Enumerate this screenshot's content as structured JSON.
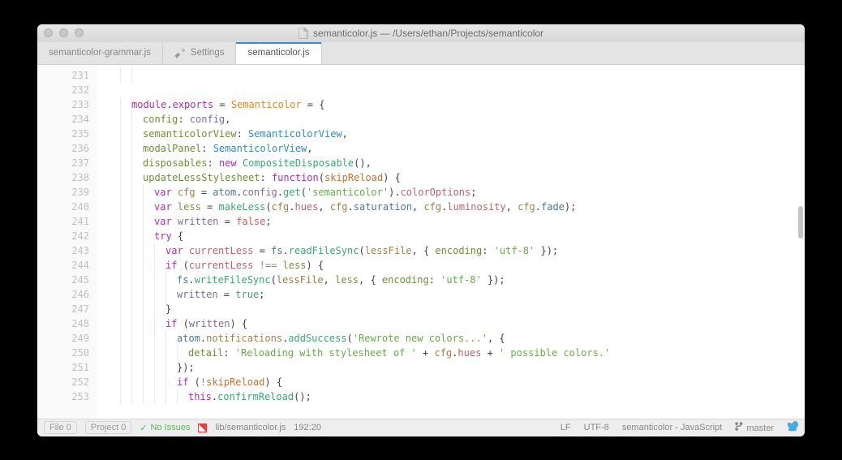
{
  "window": {
    "title": "semanticolor.js — /Users/ethan/Projects/semanticolor"
  },
  "tabs": [
    {
      "label": "semanticolor-grammar.js",
      "icon": null,
      "active": false
    },
    {
      "label": "Settings",
      "icon": "settings",
      "active": false
    },
    {
      "label": "semanticolor.js",
      "icon": null,
      "active": true
    }
  ],
  "gutter": {
    "start": 231,
    "end": 253
  },
  "code_lines": [
    {
      "indent": 2,
      "tokens": []
    },
    {
      "indent": 0,
      "tokens": []
    },
    {
      "indent": 1,
      "tokens": [
        [
          "t-kw",
          "module"
        ],
        [
          "",
          "."
        ],
        [
          "t-kw",
          "exports"
        ],
        [
          "",
          " = "
        ],
        [
          "t-clsA",
          "Semanticolor"
        ],
        [
          "",
          " = {"
        ]
      ]
    },
    {
      "indent": 2,
      "tokens": [
        [
          "t-prop",
          "config"
        ],
        [
          "",
          ": "
        ],
        [
          "t-var1",
          "config"
        ],
        [
          "",
          ","
        ]
      ]
    },
    {
      "indent": 2,
      "tokens": [
        [
          "t-prop",
          "semanticolorView"
        ],
        [
          "",
          ": "
        ],
        [
          "t-clsB",
          "SemanticolorView"
        ],
        [
          "",
          ","
        ]
      ]
    },
    {
      "indent": 2,
      "tokens": [
        [
          "t-prop",
          "modalPanel"
        ],
        [
          "",
          ": "
        ],
        [
          "t-clsB",
          "SemanticolorView"
        ],
        [
          "",
          ","
        ]
      ]
    },
    {
      "indent": 2,
      "tokens": [
        [
          "t-prop",
          "disposables"
        ],
        [
          "",
          ": "
        ],
        [
          "t-kw",
          "new"
        ],
        [
          "",
          " "
        ],
        [
          "t-clsC",
          "CompositeDisposable"
        ],
        [
          "",
          "(),"
        ]
      ]
    },
    {
      "indent": 2,
      "tokens": [
        [
          "t-prop",
          "updateLessStylesheet"
        ],
        [
          "",
          ": "
        ],
        [
          "t-kw",
          "function"
        ],
        [
          "",
          "("
        ],
        [
          "t-param",
          "skipReload"
        ],
        [
          "",
          ") {"
        ]
      ]
    },
    {
      "indent": 3,
      "tokens": [
        [
          "t-kw",
          "var"
        ],
        [
          "",
          " "
        ],
        [
          "t-var2",
          "cfg"
        ],
        [
          "",
          " = "
        ],
        [
          "t-var3",
          "atom"
        ],
        [
          "",
          "."
        ],
        [
          "t-var1",
          "config"
        ],
        [
          "",
          "."
        ],
        [
          "t-fn",
          "get"
        ],
        [
          "",
          "("
        ],
        [
          "t-str",
          "'semanticolor'"
        ],
        [
          "",
          ")."
        ],
        [
          "t-var4",
          "colorOptions"
        ],
        [
          "",
          ";"
        ]
      ]
    },
    {
      "indent": 3,
      "tokens": [
        [
          "t-kw",
          "var"
        ],
        [
          "",
          " "
        ],
        [
          "t-var5",
          "less"
        ],
        [
          "",
          " = "
        ],
        [
          "t-fn",
          "makeLess"
        ],
        [
          "",
          "("
        ],
        [
          "t-var2",
          "cfg"
        ],
        [
          "",
          "."
        ],
        [
          "t-var4",
          "hues"
        ],
        [
          "",
          ", "
        ],
        [
          "t-var2",
          "cfg"
        ],
        [
          "",
          "."
        ],
        [
          "t-var3",
          "saturation"
        ],
        [
          "",
          ", "
        ],
        [
          "t-var2",
          "cfg"
        ],
        [
          "",
          "."
        ],
        [
          "t-var4",
          "luminosity"
        ],
        [
          "",
          ", "
        ],
        [
          "t-var2",
          "cfg"
        ],
        [
          "",
          "."
        ],
        [
          "t-var3",
          "fade"
        ],
        [
          "",
          ");"
        ]
      ]
    },
    {
      "indent": 3,
      "tokens": [
        [
          "t-kw",
          "var"
        ],
        [
          "",
          " "
        ],
        [
          "t-var1",
          "written"
        ],
        [
          "",
          " = "
        ],
        [
          "t-false",
          "false"
        ],
        [
          "",
          ";"
        ]
      ]
    },
    {
      "indent": 3,
      "tokens": [
        [
          "t-kw",
          "try"
        ],
        [
          "",
          " {"
        ]
      ]
    },
    {
      "indent": 4,
      "tokens": [
        [
          "t-kw",
          "var"
        ],
        [
          "",
          " "
        ],
        [
          "t-var4",
          "currentLess"
        ],
        [
          "",
          " = "
        ],
        [
          "t-var3",
          "fs"
        ],
        [
          "",
          "."
        ],
        [
          "t-fn",
          "readFileSync"
        ],
        [
          "",
          "("
        ],
        [
          "t-var2",
          "lessFile"
        ],
        [
          "",
          ", { "
        ],
        [
          "t-prop",
          "encoding"
        ],
        [
          "",
          ": "
        ],
        [
          "t-str",
          "'utf-8'"
        ],
        [
          "",
          " });"
        ]
      ]
    },
    {
      "indent": 4,
      "tokens": [
        [
          "t-kw",
          "if"
        ],
        [
          "",
          " ("
        ],
        [
          "t-var4",
          "currentLess"
        ],
        [
          "",
          " "
        ],
        [
          "t-op",
          "!=="
        ],
        [
          "",
          " "
        ],
        [
          "t-var5",
          "less"
        ],
        [
          "",
          ") {"
        ]
      ]
    },
    {
      "indent": 5,
      "tokens": [
        [
          "t-var3",
          "fs"
        ],
        [
          "",
          "."
        ],
        [
          "t-fn",
          "writeFileSync"
        ],
        [
          "",
          "("
        ],
        [
          "t-var2",
          "lessFile"
        ],
        [
          "",
          ", "
        ],
        [
          "t-var5",
          "less"
        ],
        [
          "",
          ", { "
        ],
        [
          "t-prop",
          "encoding"
        ],
        [
          "",
          ": "
        ],
        [
          "t-str",
          "'utf-8'"
        ],
        [
          "",
          " });"
        ]
      ]
    },
    {
      "indent": 5,
      "tokens": [
        [
          "t-var1",
          "written"
        ],
        [
          "",
          " = "
        ],
        [
          "t-true",
          "true"
        ],
        [
          "",
          ";"
        ]
      ]
    },
    {
      "indent": 4,
      "tokens": [
        [
          "",
          "}"
        ]
      ]
    },
    {
      "indent": 4,
      "tokens": [
        [
          "t-kw",
          "if"
        ],
        [
          "",
          " ("
        ],
        [
          "t-var1",
          "written"
        ],
        [
          "",
          ") {"
        ]
      ]
    },
    {
      "indent": 5,
      "tokens": [
        [
          "t-var3",
          "atom"
        ],
        [
          "",
          "."
        ],
        [
          "t-var2",
          "notifications"
        ],
        [
          "",
          "."
        ],
        [
          "t-fn",
          "addSuccess"
        ],
        [
          "",
          "("
        ],
        [
          "t-str",
          "'Rewrote new colors...'"
        ],
        [
          "",
          ", {"
        ]
      ]
    },
    {
      "indent": 6,
      "tokens": [
        [
          "t-prop",
          "detail"
        ],
        [
          "",
          ": "
        ],
        [
          "t-str",
          "'Reloading with stylesheet of '"
        ],
        [
          "",
          " + "
        ],
        [
          "t-var2",
          "cfg"
        ],
        [
          "",
          "."
        ],
        [
          "t-var4",
          "hues"
        ],
        [
          "",
          " + "
        ],
        [
          "t-str",
          "' possible colors.'"
        ]
      ]
    },
    {
      "indent": 5,
      "tokens": [
        [
          "",
          "});"
        ]
      ]
    },
    {
      "indent": 5,
      "tokens": [
        [
          "t-kw",
          "if"
        ],
        [
          "",
          " ("
        ],
        [
          "t-op",
          "!"
        ],
        [
          "t-param",
          "skipReload"
        ],
        [
          "",
          ") {"
        ]
      ]
    },
    {
      "indent": 6,
      "tokens": [
        [
          "t-kw",
          "this"
        ],
        [
          "",
          "."
        ],
        [
          "t-fn",
          "confirmReload"
        ],
        [
          "",
          "();"
        ]
      ]
    }
  ],
  "statusbar": {
    "file_count": "File  0",
    "project_count": "Project  0",
    "issues": "No Issues",
    "filepath": "lib/semanticolor.js",
    "cursor": "192:20",
    "line_ending": "LF",
    "encoding": "UTF-8",
    "grammar": "semanticolor - JavaScript",
    "branch": "master"
  }
}
